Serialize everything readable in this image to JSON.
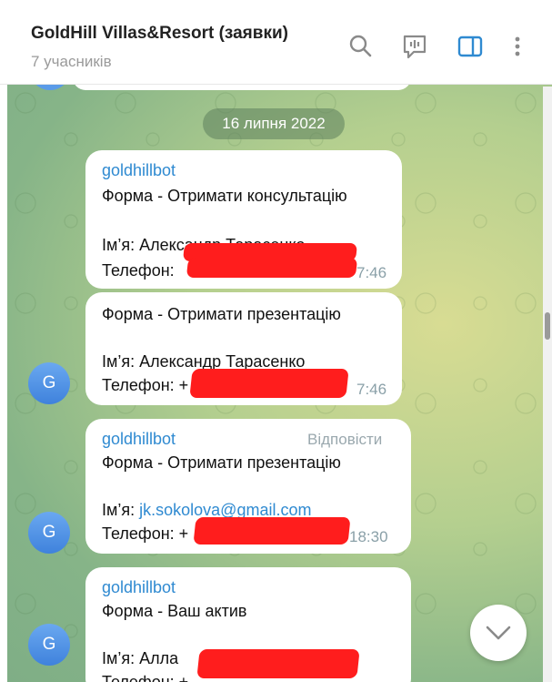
{
  "header": {
    "title": "GoldHill Villas&Resort (заявки)",
    "subtitle": "7 учасників",
    "icons": [
      "search-icon",
      "voice-chat-icon",
      "sidebar-toggle-icon",
      "more-icon"
    ],
    "accent": "#2f8ad1"
  },
  "chat": {
    "date": "16 липня 2022",
    "messages": [
      {
        "sender": "goldhillbot",
        "line1": "Форма - Отримати консультацію",
        "line2": "Ім’я: Александр Тарасенко",
        "line3": "Телефон: ",
        "time": "7:46"
      },
      {
        "line1": "Форма - Отримати презентацію",
        "line2": "Ім’я: Александр Тарасенко",
        "line3": "Телефон: +",
        "time": "7:46",
        "avatar": "G"
      },
      {
        "sender": "goldhillbot",
        "reply": "Відповісти",
        "line1": "Форма - Отримати презентацію",
        "line2_label": "Ім’я: ",
        "line2_email": "jk.sokolova@gmail.com",
        "line3": "Телефон: +",
        "time": "18:30",
        "avatar": "G"
      },
      {
        "sender": "goldhillbot",
        "line1": "Форма - Ваш актив",
        "line2": "Ім’я: Алла",
        "line3": "Телефон: +",
        "avatar": "G"
      }
    ]
  },
  "colors": {
    "redaction": "#ff1d1d",
    "avatar": "#4a8fe3"
  }
}
